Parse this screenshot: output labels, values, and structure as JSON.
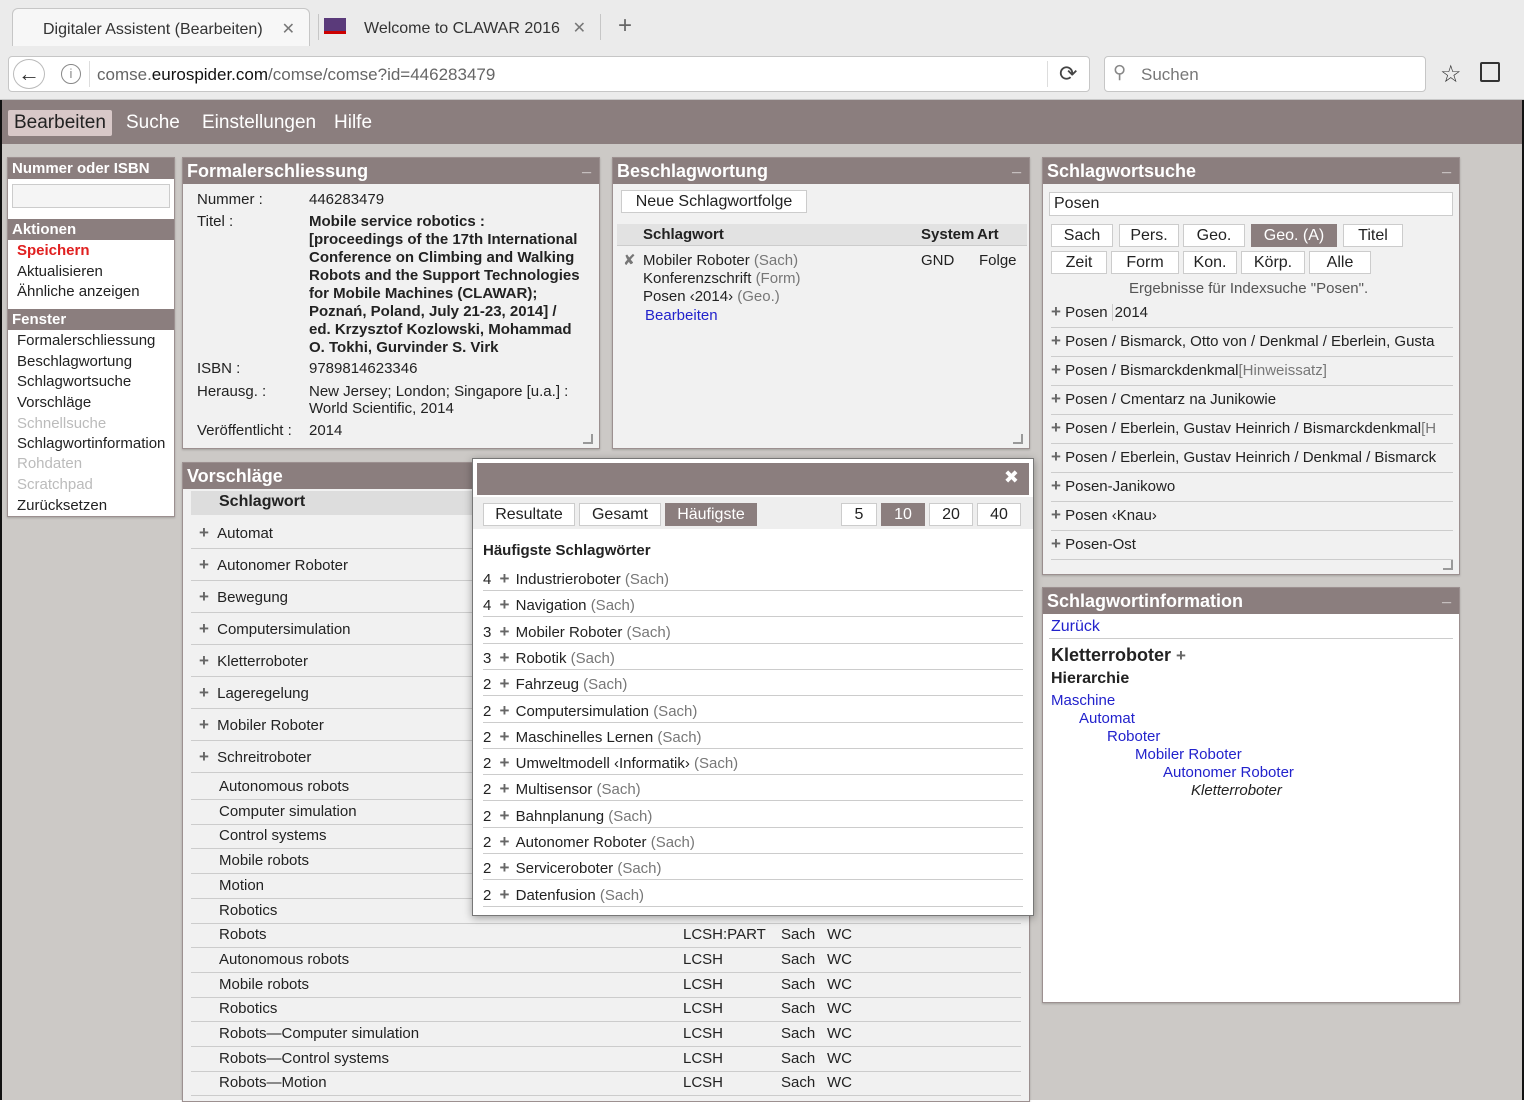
{
  "browser": {
    "tabs": [
      {
        "title": "Digitaler Assistent (Bearbeiten)",
        "close": "✕"
      },
      {
        "title": "Welcome to CLAWAR 2016",
        "close": "✕"
      }
    ],
    "new_tab": "+",
    "url_host": "comse.",
    "url_domain": "eurospider.com",
    "url_path": "/comse/comse?id=446283479",
    "search_placeholder": "Suchen"
  },
  "menu": [
    "Bearbeiten",
    "Suche",
    "Einstellungen",
    "Hilfe"
  ],
  "sidebar": {
    "number_label": "Nummer oder ISBN",
    "actions_title": "Aktionen",
    "actions": [
      "Speichern",
      "Aktualisieren",
      "Ähnliche anzeigen"
    ],
    "windows_title": "Fenster",
    "windows": [
      "Formalerschliessung",
      "Beschlagwortung",
      "Schlagwortsuche",
      "Vorschläge",
      "Schnellsuche",
      "Schlagwortinformation",
      "Rohdaten",
      "Scratchpad",
      "Zurücksetzen"
    ]
  },
  "formal": {
    "title": "Formalerschliessung",
    "min": "_",
    "nummer_label": "Nummer :",
    "nummer": "446283479",
    "titel_label": "Titel :",
    "titel_lines": [
      "Mobile service robotics :",
      "[proceedings of the 17th International",
      "Conference on Climbing and Walking",
      "Robots and the Support Technologies",
      "for Mobile Machines (CLAWAR);",
      "Poznań, Poland, July 21-23, 2014] /",
      "ed. Krzysztof Kozlowski, Mohammad",
      "O. Tokhi, Gurvinder S. Virk"
    ],
    "isbn_label": "ISBN :",
    "isbn": "9789814623346",
    "herausg_label": "Herausg. :",
    "herausg_lines": [
      "New Jersey; London; Singapore [u.a.] :",
      "World Scientific, 2014"
    ],
    "veroeff_label": "Veröffentlicht :",
    "veroeff": "2014"
  },
  "beschlag": {
    "title": "Beschlagwortung",
    "min": "_",
    "new_button": "Neue Schlagwortfolge",
    "col_schlagwort": "Schlagwort",
    "col_system": "System",
    "col_art": "Art",
    "remove": "✘",
    "entries": [
      {
        "term": "Mobiler Roboter",
        "type": "(Sach)"
      },
      {
        "term": "Konferenzschrift",
        "type": "(Form)"
      },
      {
        "term": "Posen ‹2014›",
        "type": "(Geo.)"
      }
    ],
    "system": "GND",
    "art": "Folge",
    "edit_link": "Bearbeiten"
  },
  "suche": {
    "title": "Schlagwortsuche",
    "min": "_",
    "query": "Posen",
    "filters_row1": [
      "Sach",
      "Pers.",
      "Geo.",
      "Geo. (A)",
      "Titel"
    ],
    "filters_row2": [
      "Zeit",
      "Form",
      "Kon.",
      "Körp.",
      "Alle"
    ],
    "results_caption": "Ergebnisse für Indexsuche \"Posen\".",
    "results": [
      {
        "text": "Posen",
        "extra": "2014",
        "hint": ""
      },
      {
        "text": "Posen / Bismarck, Otto von / Denkmal / Eberlein, Gusta",
        "extra": "",
        "hint": ""
      },
      {
        "text": "Posen / Bismarckdenkmal",
        "extra": "",
        "hint": "[Hinweissatz]"
      },
      {
        "text": "Posen / Cmentarz na Junikowie",
        "extra": "",
        "hint": ""
      },
      {
        "text": "Posen / Eberlein, Gustav Heinrich / Bismarckdenkmal",
        "extra": "",
        "hint": "[H"
      },
      {
        "text": "Posen / Eberlein, Gustav Heinrich / Denkmal / Bismarck",
        "extra": "",
        "hint": ""
      },
      {
        "text": "Posen-Janikowo",
        "extra": "",
        "hint": ""
      },
      {
        "text": "Posen ‹Knau›",
        "extra": "",
        "hint": ""
      },
      {
        "text": "Posen-Ost",
        "extra": "",
        "hint": ""
      }
    ]
  },
  "info": {
    "title": "Schlagwortinformation",
    "min": "_",
    "back": "Zurück",
    "heading": "Kletterroboter",
    "hier_title": "Hierarchie",
    "hierarchy": [
      "Maschine",
      "Automat",
      "Roboter",
      "Mobiler Roboter",
      "Autonomer Roboter",
      "Kletterroboter"
    ]
  },
  "vorschlaege": {
    "title": "Vorschläge",
    "col": "Schlagwort",
    "plus_items": [
      "Automat",
      "Autonomer Roboter",
      "Bewegung",
      "Computersimulation",
      "Kletterroboter",
      "Lageregelung",
      "Mobiler Roboter",
      "Schreitroboter"
    ],
    "plain_items": [
      "Autonomous robots",
      "Computer simulation",
      "Control systems",
      "Mobile robots",
      "Motion",
      "Robotics"
    ],
    "table_rows": [
      {
        "term": "Robots",
        "src": "LCSH:PART",
        "type": "Sach",
        "db": "WC"
      },
      {
        "term": "Autonomous robots",
        "src": "LCSH",
        "type": "Sach",
        "db": "WC"
      },
      {
        "term": "Mobile robots",
        "src": "LCSH",
        "type": "Sach",
        "db": "WC"
      },
      {
        "term": "Robotics",
        "src": "LCSH",
        "type": "Sach",
        "db": "WC"
      },
      {
        "term": "Robots—Computer simulation",
        "src": "LCSH",
        "type": "Sach",
        "db": "WC"
      },
      {
        "term": "Robots—Control systems",
        "src": "LCSH",
        "type": "Sach",
        "db": "WC"
      },
      {
        "term": "Robots—Motion",
        "src": "LCSH",
        "type": "Sach",
        "db": "WC"
      }
    ]
  },
  "popup": {
    "close": "✖",
    "tabs": [
      "Resultate",
      "Gesamt",
      "Häufigste"
    ],
    "counts": [
      "5",
      "10",
      "20",
      "40"
    ],
    "heading": "Häufigste Schlagwörter",
    "items": [
      {
        "n": "4",
        "term": "Industrieroboter",
        "type": "(Sach)"
      },
      {
        "n": "4",
        "term": "Navigation",
        "type": "(Sach)"
      },
      {
        "n": "3",
        "term": "Mobiler Roboter",
        "type": "(Sach)"
      },
      {
        "n": "3",
        "term": "Robotik",
        "type": "(Sach)"
      },
      {
        "n": "2",
        "term": "Fahrzeug",
        "type": "(Sach)"
      },
      {
        "n": "2",
        "term": "Computersimulation",
        "type": "(Sach)"
      },
      {
        "n": "2",
        "term": "Maschinelles Lernen",
        "type": "(Sach)"
      },
      {
        "n": "2",
        "term": "Umweltmodell ‹Informatik›",
        "type": "(Sach)"
      },
      {
        "n": "2",
        "term": "Multisensor",
        "type": "(Sach)"
      },
      {
        "n": "2",
        "term": "Bahnplanung",
        "type": "(Sach)"
      },
      {
        "n": "2",
        "term": "Autonomer Roboter",
        "type": "(Sach)"
      },
      {
        "n": "2",
        "term": "Serviceroboter",
        "type": "(Sach)"
      },
      {
        "n": "2",
        "term": "Datenfusion",
        "type": "(Sach)"
      }
    ]
  }
}
